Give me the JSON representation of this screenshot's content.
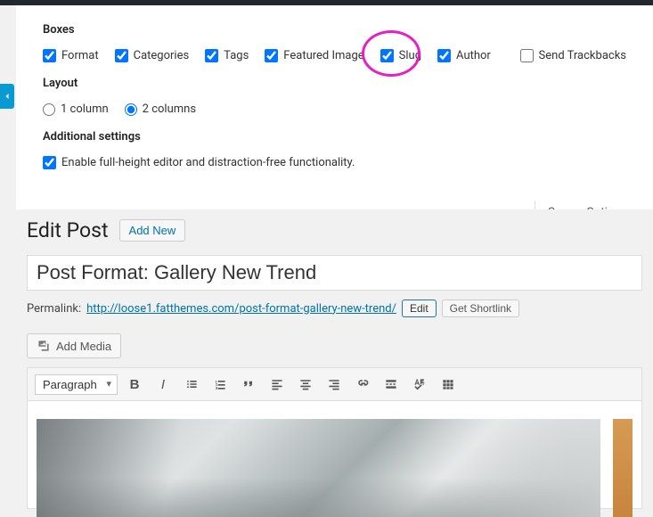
{
  "screenOptions": {
    "boxesHeading": "Boxes",
    "boxes": {
      "format": "Format",
      "categories": "Categories",
      "tags": "Tags",
      "featuredImage": "Featured Image",
      "slug": "Slug",
      "author": "Author",
      "sendTrackbacks": "Send Trackbacks"
    },
    "layoutHeading": "Layout",
    "layout": {
      "col1": "1 column",
      "col2": "2 columns"
    },
    "additionalHeading": "Additional settings",
    "additional": {
      "fullHeightEditor": "Enable full-height editor and distraction-free functionality."
    },
    "tabLabel": "Screen Options"
  },
  "page": {
    "heading": "Edit Post",
    "addNew": "Add New",
    "title": "Post Format: Gallery New Trend",
    "permalinkLabel": "Permalink:",
    "permalinkUrl": "http://loose1.fatthemes.com/post-format-gallery-new-trend/",
    "editBtn": "Edit",
    "getShortlink": "Get Shortlink",
    "addMedia": "Add Media"
  },
  "editor": {
    "formatSelect": "Paragraph"
  }
}
